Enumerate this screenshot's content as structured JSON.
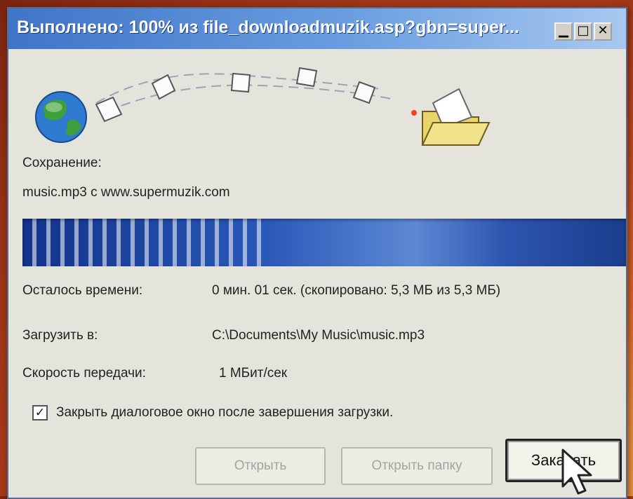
{
  "window": {
    "title": "Выполнено: 100% из file_downloadmuzik.asp?gbn=super...",
    "minimize_symbol": "▁",
    "maximize_symbol": "□",
    "close_symbol": "✕"
  },
  "animation": {
    "source_icon": "globe-icon",
    "items_icon": "flying-document-icon",
    "destination_icon": "folder-icon"
  },
  "status": {
    "saving_label": "Сохранение:",
    "file_source": "music.mp3 с www.supermuzik.com",
    "progress_percent": 100,
    "time_left_label": "Осталось времени:",
    "time_left_value": "0 мин. 01 сек. (скопировано: 5,3 МБ из 5,3 МБ)",
    "download_to_label": "Загрузить в:",
    "download_to_value": "C:\\Documents\\My Music\\music.mp3",
    "speed_label": "Скорость передачи:",
    "speed_value": "1 МБит/сек"
  },
  "close_on_complete": {
    "checked": true,
    "check_mark": "✓",
    "label": "Закрыть диалоговое окно после завершения загрузки."
  },
  "buttons": {
    "open": "Открыть",
    "open_folder": "Открыть папку",
    "download": "Закачать"
  },
  "colors": {
    "title_bar": "#3f74c8",
    "progress": "#12338a",
    "background": "#d8622a"
  }
}
